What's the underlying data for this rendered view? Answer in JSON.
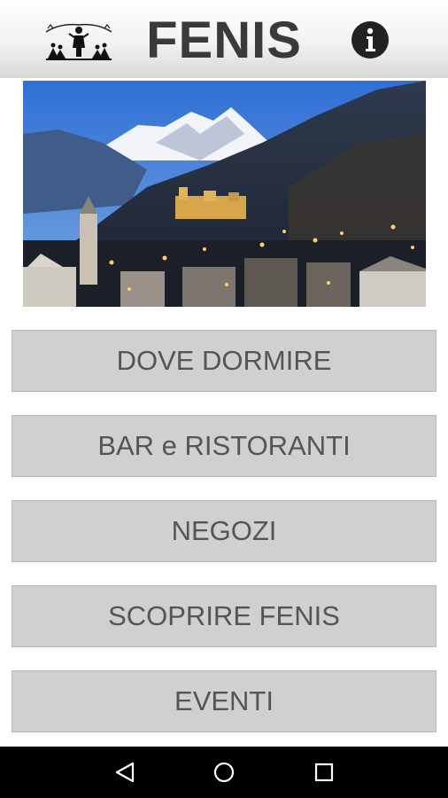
{
  "app": {
    "title": "FENIS",
    "logo_icon": "group-people-logo-icon",
    "info_icon": "info-icon"
  },
  "hero_image": {
    "subject": "village-castle-mountains-photo"
  },
  "menu": {
    "items": [
      {
        "label": "DOVE DORMIRE"
      },
      {
        "label": "BAR e RISTORANTI"
      },
      {
        "label": "NEGOZI"
      },
      {
        "label": "SCOPRIRE FENIS"
      },
      {
        "label": "EVENTI"
      }
    ]
  },
  "navbar": {
    "back_icon": "back-triangle-icon",
    "home_icon": "home-circle-icon",
    "recents_icon": "recents-square-icon"
  },
  "colors": {
    "button_bg": "#d0d0d0",
    "button_text": "#555555",
    "title_text": "#3a3a3a",
    "navbar_bg": "#000000"
  }
}
